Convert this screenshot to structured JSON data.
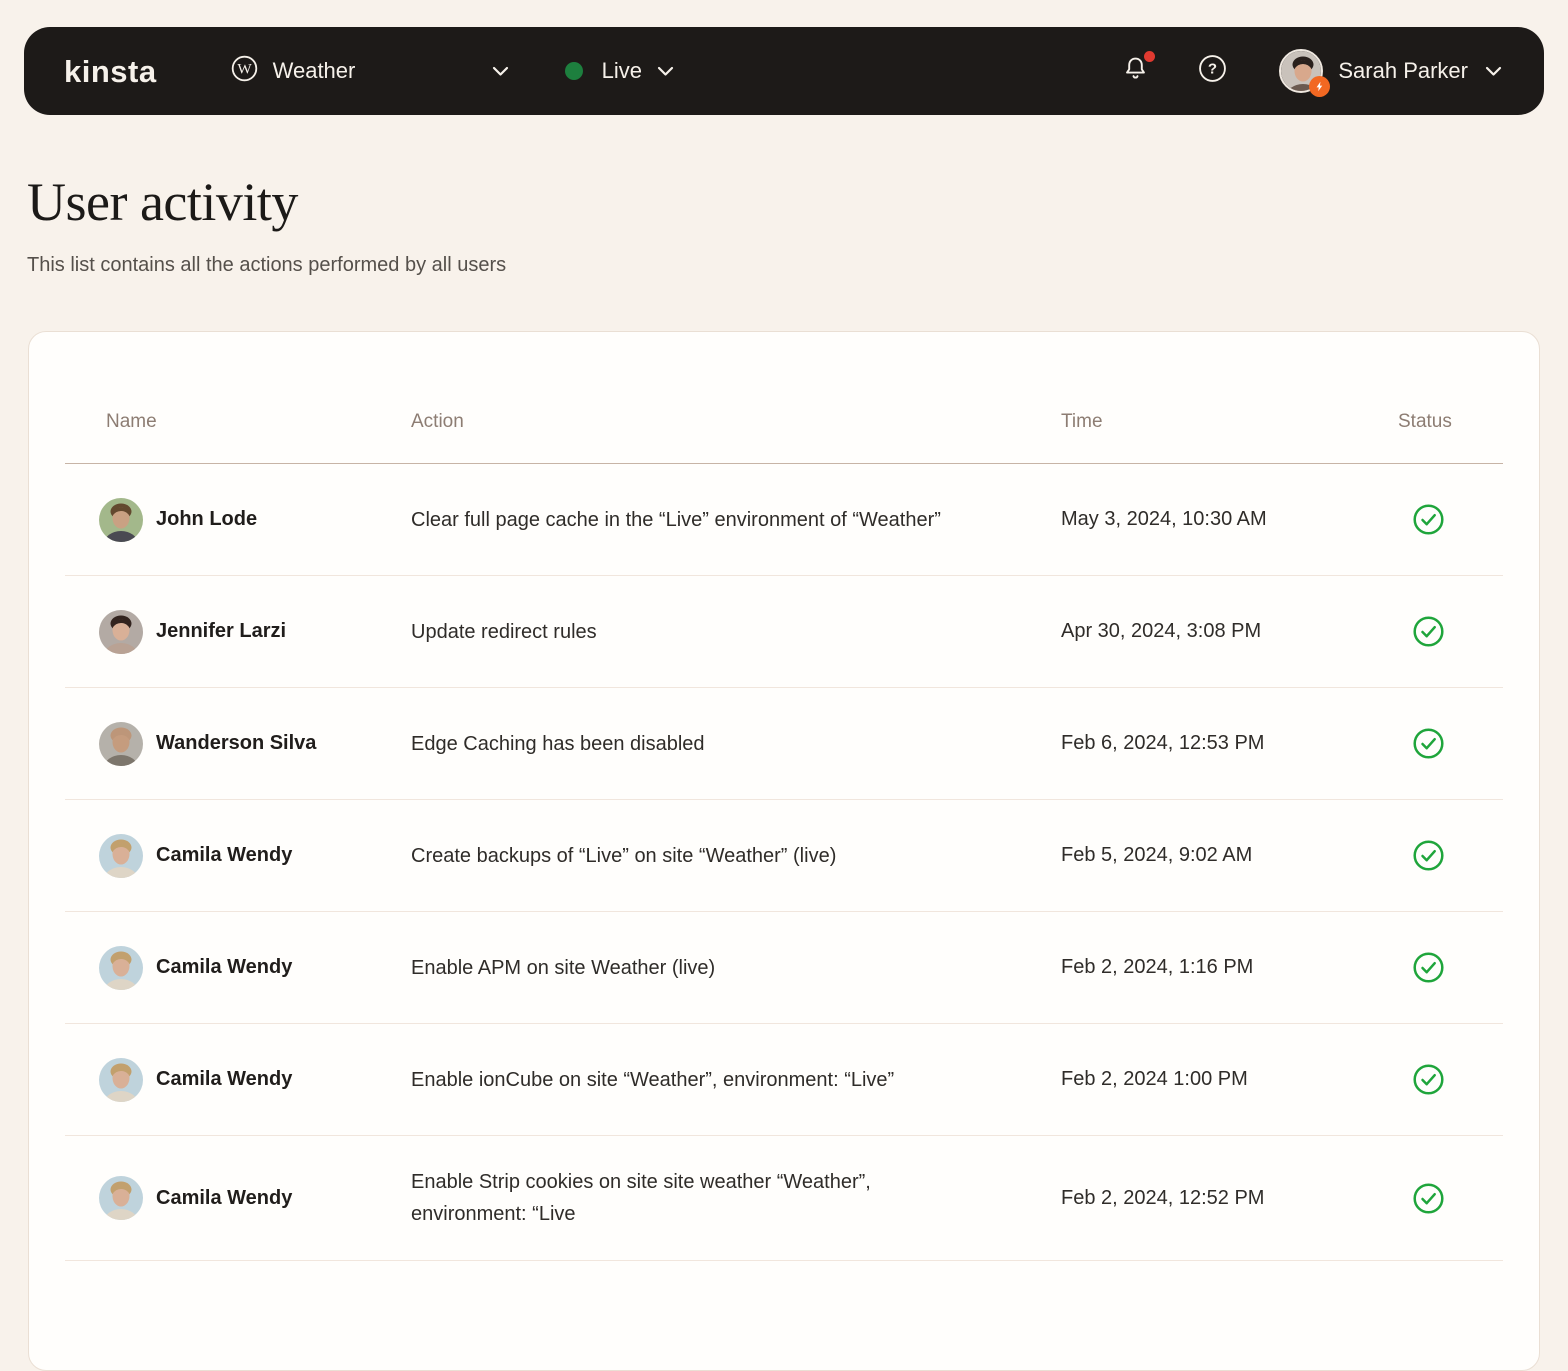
{
  "navbar": {
    "logo": "kinsta",
    "site_selector": {
      "label": "Weather",
      "icon": "wordpress-icon"
    },
    "env_selector": {
      "label": "Live",
      "status_color": "#1d7f3e"
    },
    "notifications": {
      "unread": true
    },
    "user": {
      "name": "Sarah Parker",
      "avatar": {
        "bg": "#c9c2bb",
        "hair": "#2a211d",
        "skin": "#d8a88c",
        "shirt": "#6b5a50"
      }
    }
  },
  "page": {
    "title": "User activity",
    "subtitle": "This list contains all the actions performed by all users"
  },
  "table": {
    "columns": [
      "Name",
      "Action",
      "Time",
      "Status"
    ],
    "rows": [
      {
        "name": "John Lode",
        "action": "Clear full page cache in the “Live” environment of “Weather”",
        "time": "May 3, 2024, 10:30 AM",
        "status": "success",
        "avatar": {
          "bg": "#a3b88b",
          "hair": "#63492f",
          "skin": "#c9a183",
          "shirt": "#4a4a52"
        }
      },
      {
        "name": "Jennifer Larzi",
        "action": "Update redirect rules",
        "time": "Apr 30, 2024, 3:08 PM",
        "status": "success",
        "avatar": {
          "bg": "#b3aaa4",
          "hair": "#33241f",
          "skin": "#d9b097",
          "shirt": "#b9a294"
        }
      },
      {
        "name": "Wanderson Silva",
        "action": "Edge Caching has been disabled",
        "time": "Feb 6, 2024, 12:53 PM",
        "status": "success",
        "avatar": {
          "bg": "#b5b1aa",
          "hair": "#bd9679",
          "skin": "#c59c7e",
          "shirt": "#7d766c"
        }
      },
      {
        "name": "Camila Wendy",
        "action": "Create backups of “Live” on site “Weather” (live)",
        "time": "Feb 5, 2024, 9:02 AM",
        "status": "success",
        "avatar": {
          "bg": "#bfd3dc",
          "hair": "#c2a06d",
          "skin": "#d9b097",
          "shirt": "#ded5c6"
        }
      },
      {
        "name": "Camila Wendy",
        "action": "Enable APM on site Weather (live)",
        "time": "Feb 2, 2024, 1:16 PM",
        "status": "success",
        "avatar": {
          "bg": "#bfd3dc",
          "hair": "#c2a06d",
          "skin": "#d9b097",
          "shirt": "#ded5c6"
        }
      },
      {
        "name": "Camila Wendy",
        "action": "Enable ionCube on site “Weather”, environment: “Live”",
        "time": "Feb 2, 2024 1:00 PM",
        "status": "success",
        "avatar": {
          "bg": "#bfd3dc",
          "hair": "#c2a06d",
          "skin": "#d9b097",
          "shirt": "#ded5c6"
        }
      },
      {
        "name": "Camila Wendy",
        "action": "Enable Strip cookies on site site weather “Weather”, environment: “Live",
        "time": "Feb 2, 2024, 12:52 PM",
        "status": "success",
        "avatar": {
          "bg": "#bfd3dc",
          "hair": "#c2a06d",
          "skin": "#d9b097",
          "shirt": "#ded5c6"
        }
      }
    ]
  },
  "colors": {
    "page_bg": "#f8f2eb",
    "navbar_bg": "#1d1a18",
    "card_bg": "#fffefc",
    "success": "#1fa53b",
    "live_dot": "#1d7f3e",
    "notification_dot": "#e03a30",
    "badge_orange": "#f26822"
  }
}
